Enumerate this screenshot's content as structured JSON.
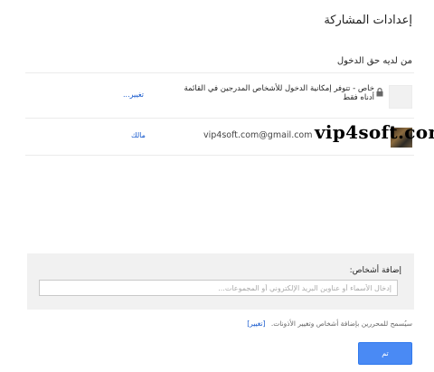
{
  "dialog": {
    "title": "إعدادات المشاركة",
    "access_label": "من لديه حق الدخول"
  },
  "access_rows": [
    {
      "icon": "lock-icon",
      "description": "خاص - تتوفر إمكانية الدخول للأشخاص المدرجين في القائمة أدناه فقط",
      "action_label": "تغيير..."
    },
    {
      "icon": "avatar",
      "email": "vip4soft.com@gmail.com",
      "role_label": "مالك"
    }
  ],
  "watermark": "vip4soft.com",
  "add_people": {
    "label": "إضافة أشخاص:",
    "placeholder": "إدخال الأسماء أو عناوين البريد الإلكتروني أو المجموعات..."
  },
  "footer": {
    "note": "سيُسمح للمحررين بإضافة أشخاص وتغيير الأذونات.",
    "change_label": "[تغيير]"
  },
  "buttons": {
    "done_label": "تم"
  },
  "colors": {
    "accent": "#4a8af4",
    "link": "#1155cc",
    "panel_bg": "#f1f1f1"
  }
}
